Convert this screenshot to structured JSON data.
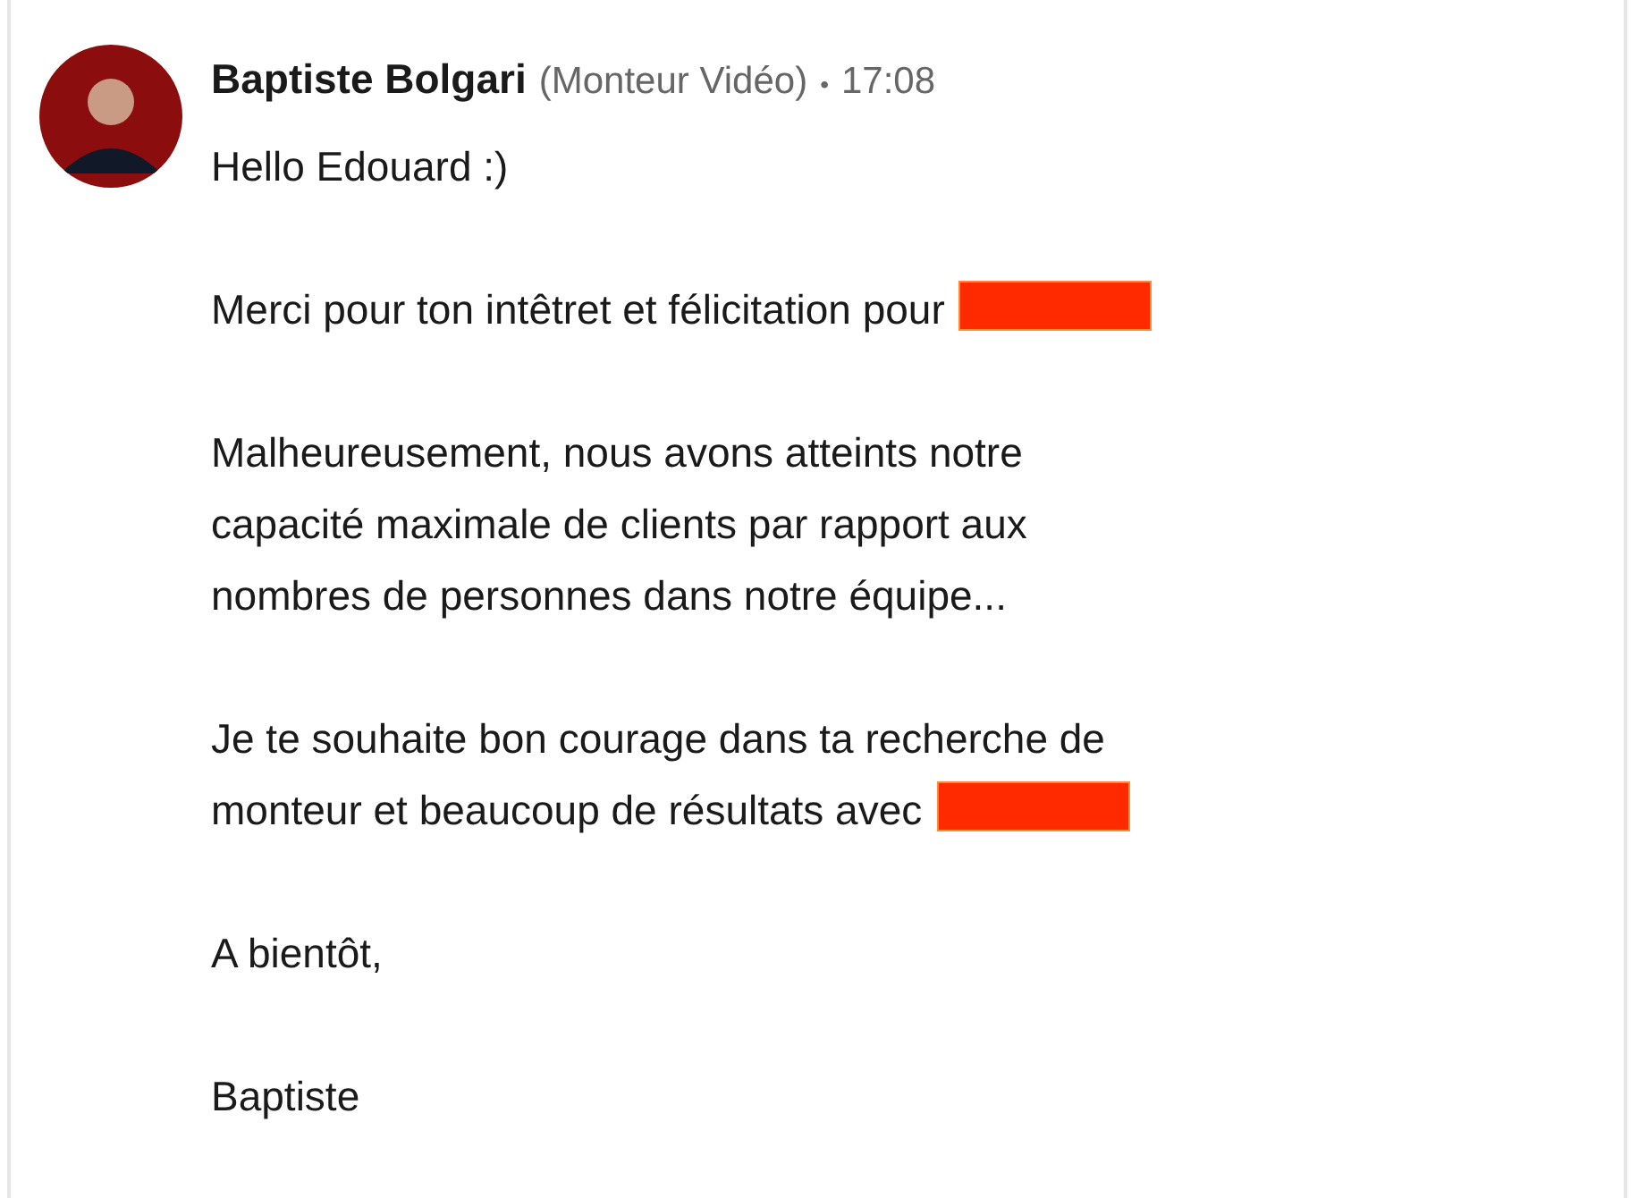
{
  "message": {
    "sender": "Baptiste Bolgari",
    "role": "(Monteur Vidéo)",
    "separator": "•",
    "time": "17:08",
    "paragraphs": [
      {
        "lines": [
          "Hello Edouard :)"
        ],
        "redacted": false
      },
      {
        "lines": [
          "Merci pour ton intêtret et félicitation pour"
        ],
        "redacted": true
      },
      {
        "lines": [
          "Malheureusement, nous avons atteints notre",
          "capacité maximale de clients par rapport aux",
          "nombres de personnes dans notre équipe..."
        ],
        "redacted": false
      },
      {
        "lines": [
          "Je te souhaite bon courage dans ta recherche de",
          "monteur et beaucoup de résultats avec"
        ],
        "redacted": true
      },
      {
        "lines": [
          "A bientôt,"
        ],
        "redacted": false
      },
      {
        "lines": [
          "Baptiste"
        ],
        "redacted": false
      }
    ]
  }
}
